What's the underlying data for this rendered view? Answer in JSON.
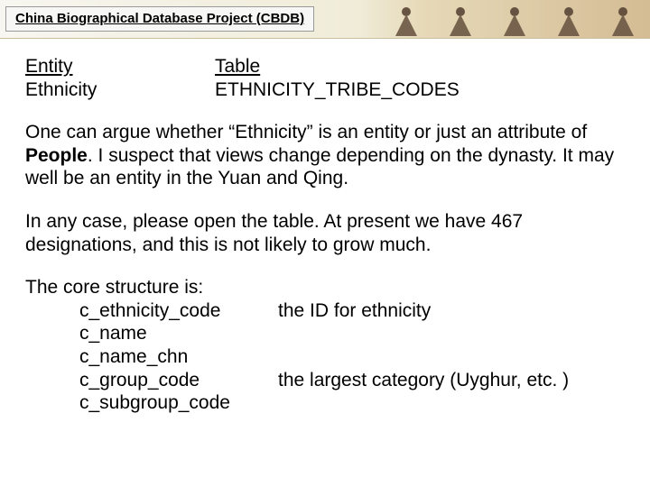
{
  "header": {
    "title": "China Biographical Database Project (CBDB)"
  },
  "headings": {
    "entity_label": "Entity",
    "entity_value": "Ethnicity",
    "table_label": "Table",
    "table_value": "ETHNICITY_TRIBE_CODES"
  },
  "para1": {
    "pre": "One can argue whether “Ethnicity” is an entity or just an attribute of ",
    "bold": "People",
    "post": ".  I suspect that views change depending on the dynasty.  It may well be an entity in the Yuan and Qing."
  },
  "para2": "In any case, please open the table.  At present we have 467 designations, and this is not likely to grow much.",
  "structure": {
    "intro": "The core structure is:",
    "fields": [
      {
        "name": "c_ethnicity_code",
        "desc": "the ID for ethnicity"
      },
      {
        "name": "c_name",
        "desc": ""
      },
      {
        "name": "c_name_chn",
        "desc": ""
      },
      {
        "name": "c_group_code",
        "desc": "the largest category (Uyghur, etc. )"
      },
      {
        "name": "c_subgroup_code",
        "desc": ""
      }
    ]
  }
}
